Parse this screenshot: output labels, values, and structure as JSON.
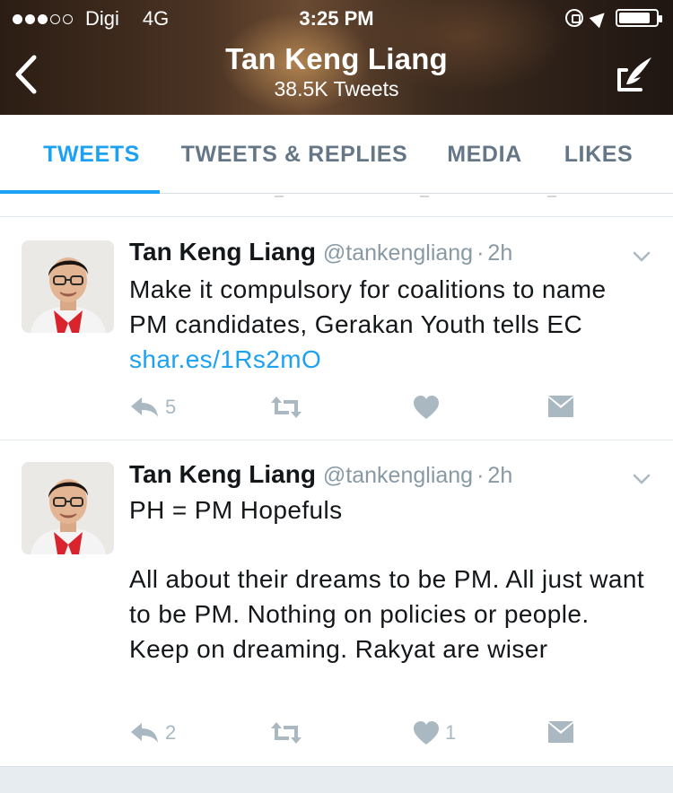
{
  "status_bar": {
    "carrier": "Digi",
    "network": "4G",
    "time": "3:25 PM",
    "signal_bars_filled": 3,
    "signal_bars_total": 5,
    "battery_level": 0.85
  },
  "header": {
    "title": "Tan Keng Liang",
    "subtitle": "38.5K Tweets"
  },
  "tabs": [
    {
      "label": "TWEETS",
      "active": true
    },
    {
      "label": "TWEETS & REPLIES",
      "active": false
    },
    {
      "label": "MEDIA",
      "active": false
    },
    {
      "label": "LIKES",
      "active": false
    }
  ],
  "colors": {
    "accent": "#1da1f2",
    "muted": "#8899a6",
    "text": "#14171a",
    "action_gray": "#aab8c2"
  },
  "tweets": [
    {
      "name": "Tan Keng Liang",
      "handle": "@tankengliang",
      "separator": "·",
      "time": "2h",
      "text": "Make it compulsory for coalitions to name PM candidates, Gerakan Youth tells EC ",
      "link": "shar.es/1Rs2mO",
      "reply_count": "5",
      "like_count": ""
    },
    {
      "name": "Tan Keng Liang",
      "handle": "@tankengliang",
      "separator": "·",
      "time": "2h",
      "text_line1": "PH = PM Hopefuls",
      "text_body": "All about their dreams to be PM. All just want to be PM. Nothing on policies or people. Keep on dreaming. Rakyat are wiser",
      "reply_count": "2",
      "like_count": "1"
    }
  ],
  "icons": [
    "back-chevron-icon",
    "compose-tweet-icon",
    "caret-down-icon",
    "reply-icon",
    "retweet-icon",
    "heart-icon",
    "direct-message-icon"
  ]
}
